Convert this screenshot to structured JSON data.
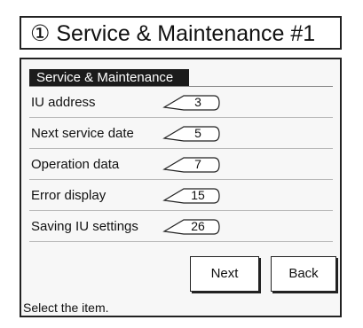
{
  "title": {
    "number_mark": "①",
    "text": "Service & Maintenance #1"
  },
  "panel": {
    "header": "Service & Maintenance",
    "items": [
      {
        "label": "IU address",
        "ref": "3"
      },
      {
        "label": "Next service date",
        "ref": "5"
      },
      {
        "label": "Operation data",
        "ref": "7"
      },
      {
        "label": "Error display",
        "ref": "15"
      },
      {
        "label": "Saving IU settings",
        "ref": "26"
      }
    ]
  },
  "buttons": {
    "next": "Next",
    "back": "Back"
  },
  "status": "Select the item."
}
